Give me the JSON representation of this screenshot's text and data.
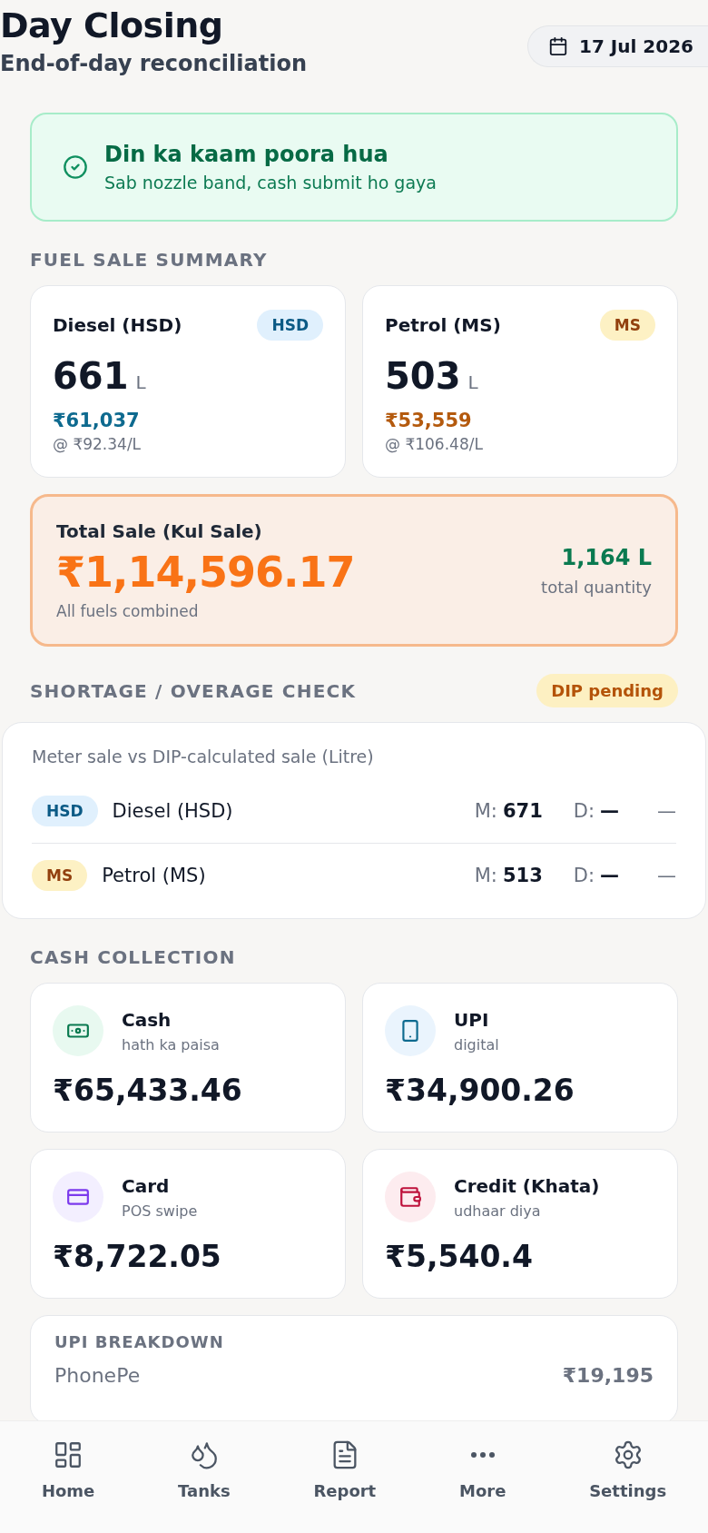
{
  "header": {
    "title": "Day Closing",
    "subtitle": "End-of-day reconciliation",
    "date": "17 Jul 2026"
  },
  "status_banner": {
    "kind": "success",
    "title": "Din ka kaam poora hua",
    "message": "Sab nozzle band, cash submit ho gaya"
  },
  "fuel_summary": {
    "heading": "FUEL SALE SUMMARY",
    "fuels": [
      {
        "kind": "hsd",
        "name": "Diesel (HSD)",
        "code": "HSD",
        "quantity": "661",
        "unit": "L",
        "amount": "₹61,037",
        "rate": "@ ₹92.34/L"
      },
      {
        "kind": "ms",
        "name": "Petrol (MS)",
        "code": "MS",
        "quantity": "503",
        "unit": "L",
        "amount": "₹53,559",
        "rate": "@ ₹106.48/L"
      }
    ],
    "total": {
      "label": "Total Sale (Kul Sale)",
      "amount": "₹1,14,596.17",
      "note": "All fuels combined",
      "quantity": "1,164 L",
      "quantity_label": "total quantity"
    }
  },
  "shortage_check": {
    "heading": "SHORTAGE / OVERAGE CHECK",
    "badge": "DIP pending",
    "caption": "Meter sale vs DIP-calculated sale (Litre)",
    "rows": [
      {
        "kind": "hsd",
        "code": "HSD",
        "name": "Diesel (HSD)",
        "meter_label": "M:",
        "meter": "671",
        "dip_label": "D:",
        "dip": "—",
        "difference": "—"
      },
      {
        "kind": "ms",
        "code": "MS",
        "name": "Petrol (MS)",
        "meter_label": "M:",
        "meter": "513",
        "dip_label": "D:",
        "dip": "—",
        "difference": "—"
      }
    ]
  },
  "cash_collection": {
    "heading": "CASH COLLECTION",
    "items": [
      {
        "kind": "cash",
        "label": "Cash",
        "sub": "hath ka paisa",
        "amount": "₹65,433.46"
      },
      {
        "kind": "upi",
        "label": "UPI",
        "sub": "digital",
        "amount": "₹34,900.26"
      },
      {
        "kind": "card",
        "label": "Card",
        "sub": "POS swipe",
        "amount": "₹8,722.05"
      },
      {
        "kind": "credit",
        "label": "Credit (Khata)",
        "sub": "udhaar diya",
        "amount": "₹5,540.4"
      }
    ]
  },
  "upi_breakdown": {
    "heading": "UPI BREAKDOWN",
    "rows": [
      {
        "name": "PhonePe",
        "amount": "₹19,195"
      }
    ]
  },
  "bottom_nav": {
    "items": [
      {
        "kind": "home",
        "label": "Home"
      },
      {
        "kind": "tanks",
        "label": "Tanks"
      },
      {
        "kind": "report",
        "label": "Report"
      },
      {
        "kind": "more",
        "label": "More"
      },
      {
        "kind": "settings",
        "label": "Settings"
      }
    ]
  }
}
